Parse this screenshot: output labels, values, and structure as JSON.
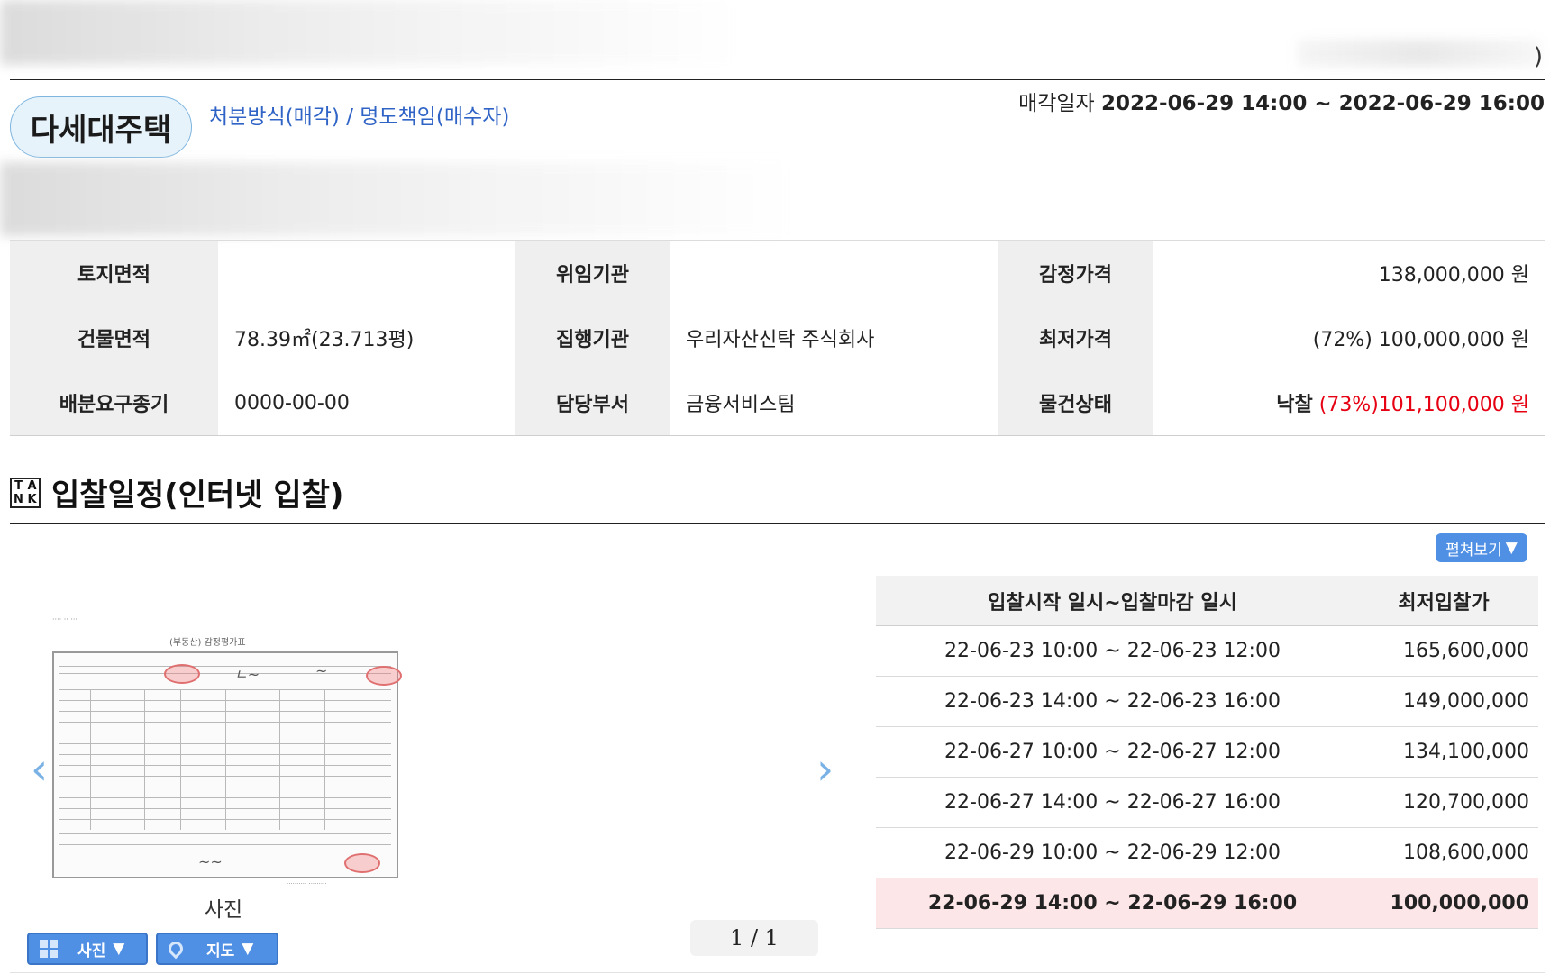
{
  "header": {
    "close_paren": ")",
    "property_type": "다세대주택",
    "method": "처분방식(매각) / 명도책임(매수자)",
    "sale_date_label": "매각일자",
    "sale_date_value": "2022-06-29 14:00 ~ 2022-06-29 16:00"
  },
  "info": {
    "land_area_label": "토지면적",
    "land_area_value": "",
    "building_area_label": "건물면적",
    "building_area_value": "78.39㎡(23.713평)",
    "dividend_deadline_label": "배분요구종기",
    "dividend_deadline_value": "0000-00-00",
    "consigner_label": "위임기관",
    "consigner_value": "",
    "executor_label": "집행기관",
    "executor_value": "우리자산신탁 주식회사",
    "department_label": "담당부서",
    "department_value": "금융서비스팀",
    "appraisal_label": "감정가격",
    "appraisal_value": "138,000,000 원",
    "min_price_label": "최저가격",
    "min_price_value": "(72%) 100,000,000 원",
    "status_label": "물건상태",
    "status_prefix": "낙찰",
    "status_value": "(73%)101,100,000 원"
  },
  "schedule": {
    "title": "입찰일정(인터넷 입찰)",
    "icon_letters": [
      "T",
      "A",
      "N",
      "K"
    ],
    "expand_label": "펼쳐보기",
    "col_range": "입찰시작 일시~입찰마감 일시",
    "col_price": "최저입찰가",
    "rows": [
      {
        "range": "22-06-23 10:00 ~ 22-06-23 12:00",
        "price": "165,600,000"
      },
      {
        "range": "22-06-23 14:00 ~ 22-06-23 16:00",
        "price": "149,000,000"
      },
      {
        "range": "22-06-27 10:00 ~ 22-06-27 12:00",
        "price": "134,100,000"
      },
      {
        "range": "22-06-27 14:00 ~ 22-06-27 16:00",
        "price": "120,700,000"
      },
      {
        "range": "22-06-29 10:00 ~ 22-06-29 12:00",
        "price": "108,600,000"
      },
      {
        "range": "22-06-29 14:00 ~ 22-06-29 16:00",
        "price": "100,000,000"
      }
    ]
  },
  "gallery": {
    "caption": "사진",
    "doc_title": "(부동산) 감정평가표",
    "pager": "1 / 1",
    "photo_button": "사진",
    "map_button": "지도"
  },
  "colors": {
    "accent_blue": "#2f63c6",
    "button_blue": "#4f8fe4",
    "red": "#e60012",
    "current_row_bg": "#fde6e8"
  }
}
